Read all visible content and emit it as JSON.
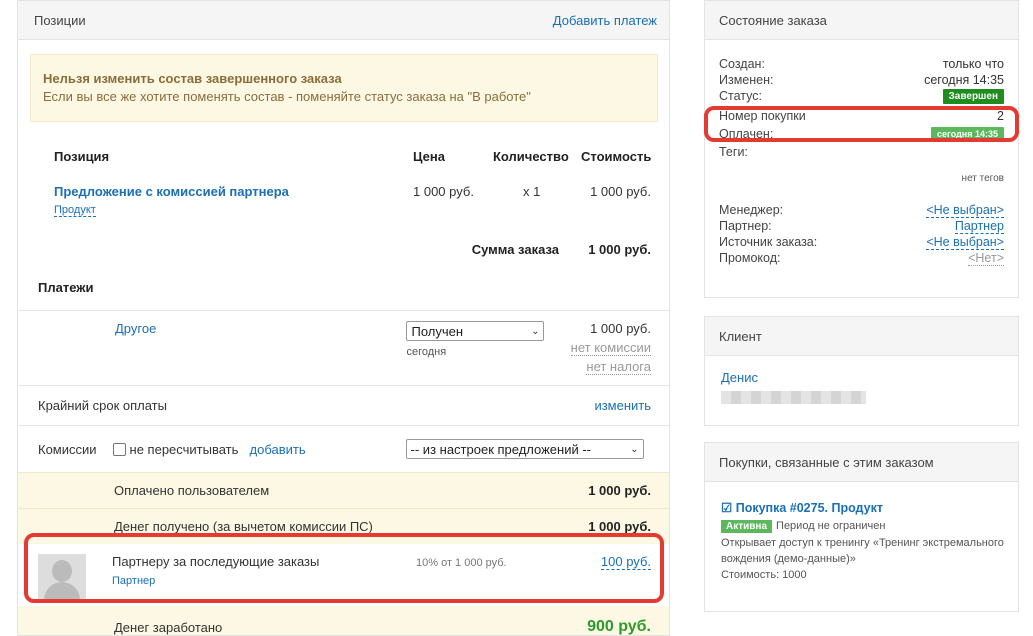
{
  "positions": {
    "header_title": "Позиции",
    "add_payment": "Добавить платеж",
    "warning_title": "Нельзя изменить состав завершенного заказа",
    "warning_text": "Если вы все же хотите поменять состав - поменяйте статус заказа на \"В работе\"",
    "columns": {
      "position": "Позиция",
      "price": "Цена",
      "qty": "Количество",
      "cost": "Стоимость"
    },
    "item": {
      "title": "Предложение с комиссией партнера",
      "type": "Продукт",
      "price": "1 000 руб.",
      "qty": "x 1",
      "cost": "1 000 руб."
    },
    "sum_label": "Сумма заказа",
    "sum_value": "1 000 руб."
  },
  "payments": {
    "title": "Платежи",
    "method": "Другое",
    "status": "Получен",
    "date": "сегодня",
    "amount": "1 000 руб.",
    "commission": "нет комиссии",
    "tax": "нет налога"
  },
  "deadline": {
    "label": "Крайний срок оплаты",
    "action": "изменить"
  },
  "commissions": {
    "label": "Комиссии",
    "checkbox_label": "не пересчитывать",
    "add": "добавить",
    "select_value": "-- из настроек предложений --"
  },
  "totals": {
    "paid_label": "Оплачено пользователем",
    "paid_value": "1 000 руб.",
    "received_label": "Денег получено (за вычетом комиссии ПС)",
    "received_value": "1 000 руб."
  },
  "partner": {
    "title": "Партнеру за последующие заказы",
    "role": "Партнер",
    "percent": "10% от 1 000 руб.",
    "amount": "100 руб."
  },
  "earned": {
    "label": "Денег заработано",
    "value": "900 руб."
  },
  "order_state": {
    "title": "Состояние заказа",
    "created_label": "Создан:",
    "created_value": "только что",
    "changed_label": "Изменен:",
    "changed_value": "сегодня 14:35",
    "status_label": "Статус:",
    "status_value": "Завершен",
    "purchase_num_label": "Номер покупки",
    "purchase_num_value": "2",
    "paid_label": "Оплачен:",
    "paid_value": "сегодня 14:35",
    "tags_label": "Теги:",
    "tags_value": "нет тегов",
    "manager_label": "Менеджер:",
    "manager_value": "<Не выбран>",
    "partner_label": "Партнер:",
    "partner_value": "Партнер",
    "source_label": "Источник заказа:",
    "source_value": "<Не выбран>",
    "promo_label": "Промокод:",
    "promo_value": "<Нет>"
  },
  "client": {
    "title": "Клиент",
    "name": "Денис"
  },
  "related": {
    "title": "Покупки, связанные с этим заказом",
    "purchase_title": "Покупка #0275. Продукт",
    "badge": "Активна",
    "period": "Период не ограничен",
    "description": "Открывает доступ к тренингу «Тренинг экстремального вождения (демо-данные)»",
    "price": "Стоимость: 1000"
  },
  "colors": {
    "accent": "#1a6fb5",
    "highlight": "#e53a32",
    "success": "#1e8c1e",
    "earned": "#2e9a2e"
  }
}
